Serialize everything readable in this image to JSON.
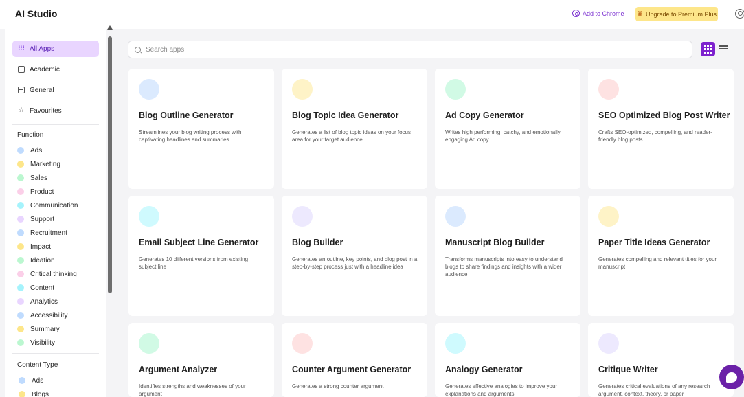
{
  "header": {
    "brand": "AI Studio",
    "add_to_chrome": "Add to Chrome",
    "upgrade": "Upgrade to Premium Plus"
  },
  "sidebar": {
    "nav": [
      {
        "label": "All Apps",
        "icon": "grid-icon",
        "active": true
      },
      {
        "label": "Academic",
        "icon": "book-icon",
        "active": false
      },
      {
        "label": "General",
        "icon": "folder-icon",
        "active": false
      },
      {
        "label": "Favourites",
        "icon": "star-icon",
        "active": false
      }
    ],
    "function_title": "Function",
    "functions": [
      {
        "label": "Ads",
        "color": "#bfdbfe"
      },
      {
        "label": "Marketing",
        "color": "#fde68a"
      },
      {
        "label": "Sales",
        "color": "#bbf7d0"
      },
      {
        "label": "Product",
        "color": "#fbcfe8"
      },
      {
        "label": "Communication",
        "color": "#a5f3fc"
      },
      {
        "label": "Support",
        "color": "#e9d5ff"
      },
      {
        "label": "Recruitment",
        "color": "#bfdbfe"
      },
      {
        "label": "Impact",
        "color": "#fde68a"
      },
      {
        "label": "Ideation",
        "color": "#bbf7d0"
      },
      {
        "label": "Critical thinking",
        "color": "#fbcfe8"
      },
      {
        "label": "Content",
        "color": "#a5f3fc"
      },
      {
        "label": "Analytics",
        "color": "#e9d5ff"
      },
      {
        "label": "Accessibility",
        "color": "#bfdbfe"
      },
      {
        "label": "Summary",
        "color": "#fde68a"
      },
      {
        "label": "Visibility",
        "color": "#bbf7d0"
      }
    ],
    "content_type_title": "Content Type",
    "content_types": [
      {
        "label": "Ads",
        "color": "#bfdbfe"
      },
      {
        "label": "Blogs",
        "color": "#fde68a"
      }
    ]
  },
  "search": {
    "placeholder": "Search apps",
    "value": ""
  },
  "cards": [
    {
      "title": "Blog Outline Generator",
      "desc": "Streamlines your blog writing process with captivating headlines and summaries",
      "color": "#dbeafe"
    },
    {
      "title": "Blog Topic Idea Generator",
      "desc": "Generates a list of blog topic ideas on your focus area for your target audience",
      "color": "#fef3c7"
    },
    {
      "title": "Ad Copy Generator",
      "desc": "Writes high performing, catchy, and emotionally engaging Ad copy",
      "color": "#d1fae5"
    },
    {
      "title": "SEO Optimized Blog Post Writer",
      "desc": "Crafts SEO-optimized, compelling, and reader-friendly blog posts",
      "color": "#fee2e2"
    },
    {
      "title": "Email Subject Line Generator",
      "desc": "Generates 10 different versions from existing subject line",
      "color": "#cffafe"
    },
    {
      "title": "Blog Builder",
      "desc": "Generates an outline, key points, and blog post in a step-by-step process just with a headline idea",
      "color": "#ede9fe"
    },
    {
      "title": "Manuscript Blog Builder",
      "desc": "Transforms manuscripts into easy to understand blogs to share findings and insights with a wider audience",
      "color": "#dbeafe"
    },
    {
      "title": "Paper Title Ideas Generator",
      "desc": "Generates compelling and relevant titles for your manuscript",
      "color": "#fef3c7"
    },
    {
      "title": "Argument Analyzer",
      "desc": "Identifies strengths and weaknesses of your argument",
      "color": "#d1fae5"
    },
    {
      "title": "Counter Argument Generator",
      "desc": "Generates a strong counter argument",
      "color": "#fee2e2"
    },
    {
      "title": "Analogy Generator",
      "desc": "Generates effective analogies to improve your explanations and arguments",
      "color": "#cffafe"
    },
    {
      "title": "Critique Writer",
      "desc": "Generates critical evaluations of any research argument, context, theory, or paper",
      "color": "#ede9fe"
    }
  ]
}
